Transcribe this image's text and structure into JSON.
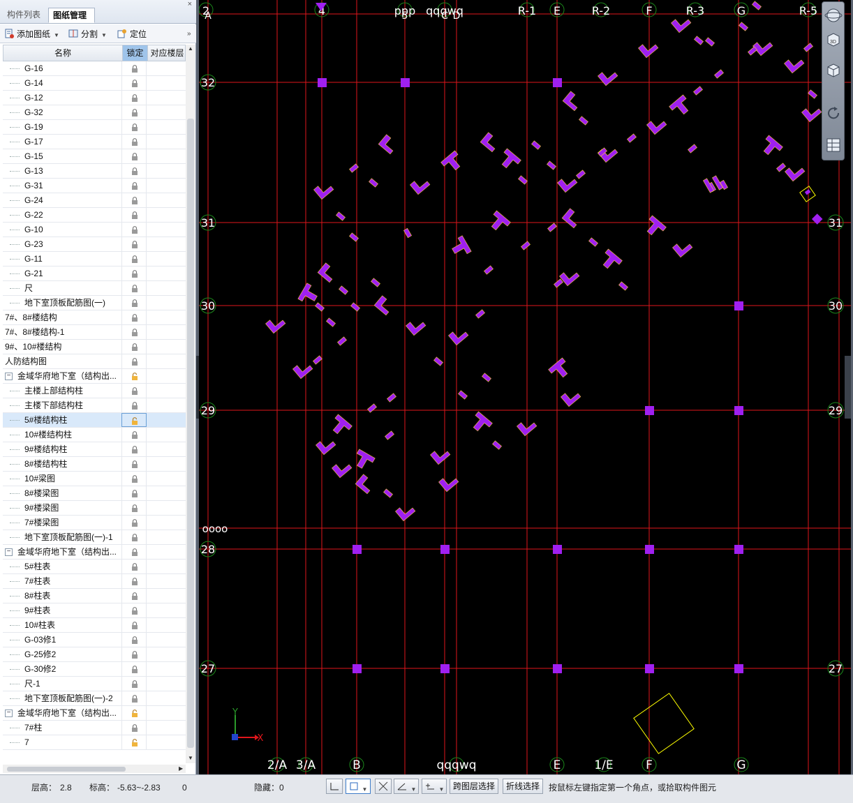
{
  "left_panel": {
    "tabs": [
      {
        "label": "构件列表"
      },
      {
        "label": "图纸管理"
      }
    ],
    "close_glyph": "×",
    "toolbar": {
      "add": "添加图纸",
      "split": "分割",
      "locate": "定位"
    },
    "columns": {
      "name": "名称",
      "lock": "锁定",
      "floor": "对应楼层"
    },
    "rows": [
      {
        "name": "G-16",
        "indent": 2,
        "lock": "locked"
      },
      {
        "name": "G-14",
        "indent": 2,
        "lock": "locked"
      },
      {
        "name": "G-12",
        "indent": 2,
        "lock": "locked"
      },
      {
        "name": "G-32",
        "indent": 2,
        "lock": "locked"
      },
      {
        "name": "G-19",
        "indent": 2,
        "lock": "locked"
      },
      {
        "name": "G-17",
        "indent": 2,
        "lock": "locked"
      },
      {
        "name": "G-15",
        "indent": 2,
        "lock": "locked"
      },
      {
        "name": "G-13",
        "indent": 2,
        "lock": "locked"
      },
      {
        "name": "G-31",
        "indent": 2,
        "lock": "locked"
      },
      {
        "name": "G-24",
        "indent": 2,
        "lock": "locked"
      },
      {
        "name": "G-22",
        "indent": 2,
        "lock": "locked"
      },
      {
        "name": "G-10",
        "indent": 2,
        "lock": "locked"
      },
      {
        "name": "G-23",
        "indent": 2,
        "lock": "locked"
      },
      {
        "name": "G-11",
        "indent": 2,
        "lock": "locked"
      },
      {
        "name": "G-21",
        "indent": 2,
        "lock": "locked"
      },
      {
        "name": "尺",
        "indent": 2,
        "lock": "locked"
      },
      {
        "name": "地下室顶板配筋图(一)",
        "indent": 2,
        "lock": "locked"
      },
      {
        "name": "7#、8#楼结构",
        "indent": 0,
        "lock": "locked"
      },
      {
        "name": "7#、8#楼结构-1",
        "indent": 0,
        "lock": "locked"
      },
      {
        "name": "9#、10#楼结构",
        "indent": 0,
        "lock": "locked"
      },
      {
        "name": "人防结构图",
        "indent": 0,
        "lock": "locked"
      },
      {
        "name": "金域华府地下室（结构出...",
        "indent": 1,
        "lock": "unlocked",
        "expander": "−"
      },
      {
        "name": "主楼上部结构柱",
        "indent": 2,
        "lock": "locked"
      },
      {
        "name": "主楼下部结构柱",
        "indent": 2,
        "lock": "locked"
      },
      {
        "name": "5#楼结构柱",
        "indent": 2,
        "lock": "unlocked",
        "selected": true
      },
      {
        "name": "10#楼结构柱",
        "indent": 2,
        "lock": "locked"
      },
      {
        "name": "9#楼结构柱",
        "indent": 2,
        "lock": "locked"
      },
      {
        "name": "8#楼结构柱",
        "indent": 2,
        "lock": "locked"
      },
      {
        "name": "10#梁图",
        "indent": 2,
        "lock": "locked"
      },
      {
        "name": "8#楼梁图",
        "indent": 2,
        "lock": "locked"
      },
      {
        "name": "9#楼梁图",
        "indent": 2,
        "lock": "locked"
      },
      {
        "name": "7#楼梁图",
        "indent": 2,
        "lock": "locked"
      },
      {
        "name": "地下室顶板配筋图(一)-1",
        "indent": 2,
        "lock": "locked"
      },
      {
        "name": "金域华府地下室（结构出...",
        "indent": 1,
        "lock": "locked",
        "expander": "−"
      },
      {
        "name": "5#柱表",
        "indent": 2,
        "lock": "locked"
      },
      {
        "name": "7#柱表",
        "indent": 2,
        "lock": "locked"
      },
      {
        "name": "8#柱表",
        "indent": 2,
        "lock": "locked"
      },
      {
        "name": "9#柱表",
        "indent": 2,
        "lock": "locked"
      },
      {
        "name": "10#柱表",
        "indent": 2,
        "lock": "locked"
      },
      {
        "name": "G-03修1",
        "indent": 2,
        "lock": "locked"
      },
      {
        "name": "G-25修2",
        "indent": 2,
        "lock": "locked"
      },
      {
        "name": "G-30修2",
        "indent": 2,
        "lock": "locked"
      },
      {
        "name": "尺-1",
        "indent": 2,
        "lock": "locked"
      },
      {
        "name": "地下室顶板配筋图(一)-2",
        "indent": 2,
        "lock": "locked"
      },
      {
        "name": "金域华府地下室（结构出...",
        "indent": 1,
        "lock": "unlocked",
        "expander": "−"
      },
      {
        "name": "7#柱",
        "indent": 2,
        "lock": "locked"
      },
      {
        "name": "7",
        "indent": 2,
        "lock": "unlocked"
      }
    ]
  },
  "canvas": {
    "top_axis_labels": [
      "2",
      "4",
      "ppp",
      "qqqwq",
      "R-1",
      "E",
      "R-2",
      "F",
      "R-3",
      "G",
      "R-5"
    ],
    "top_axis_extra": [
      "A",
      "5",
      "C",
      "D"
    ],
    "bottom_axis_labels": [
      "2/A",
      "3/A",
      "B",
      "qqqwq",
      "E",
      "1/E",
      "F",
      "G"
    ],
    "left_axis_labels": [
      "32",
      "31",
      "30",
      "29",
      "28",
      "27"
    ],
    "right_axis_labels": [
      "31",
      "30",
      "29",
      "27"
    ],
    "misc_label": "oooo",
    "axis_names": {
      "x": "X",
      "y": "Y"
    },
    "colors": {
      "grid": "#e0161b",
      "column": "#a020f0",
      "background": "#000000",
      "selection": "#ffff00"
    }
  },
  "view_toolbar": {
    "icons": [
      "orbit-icon",
      "3d-view-icon",
      "box-view-icon",
      "rotate-icon",
      "layers-icon"
    ]
  },
  "status_bar": {
    "floor_height_label": "层高：",
    "floor_height_value": "2.8",
    "elevation_label": "标高：",
    "elevation_value": "-5.63~-2.83",
    "count": "0",
    "hidden_label": "隐藏：",
    "hidden_value": "0",
    "cross_layer": "跨图层选择",
    "polyline_select": "折线选择",
    "prompt": "按鼠标左键指定第一个角点，或拾取构件图元"
  }
}
